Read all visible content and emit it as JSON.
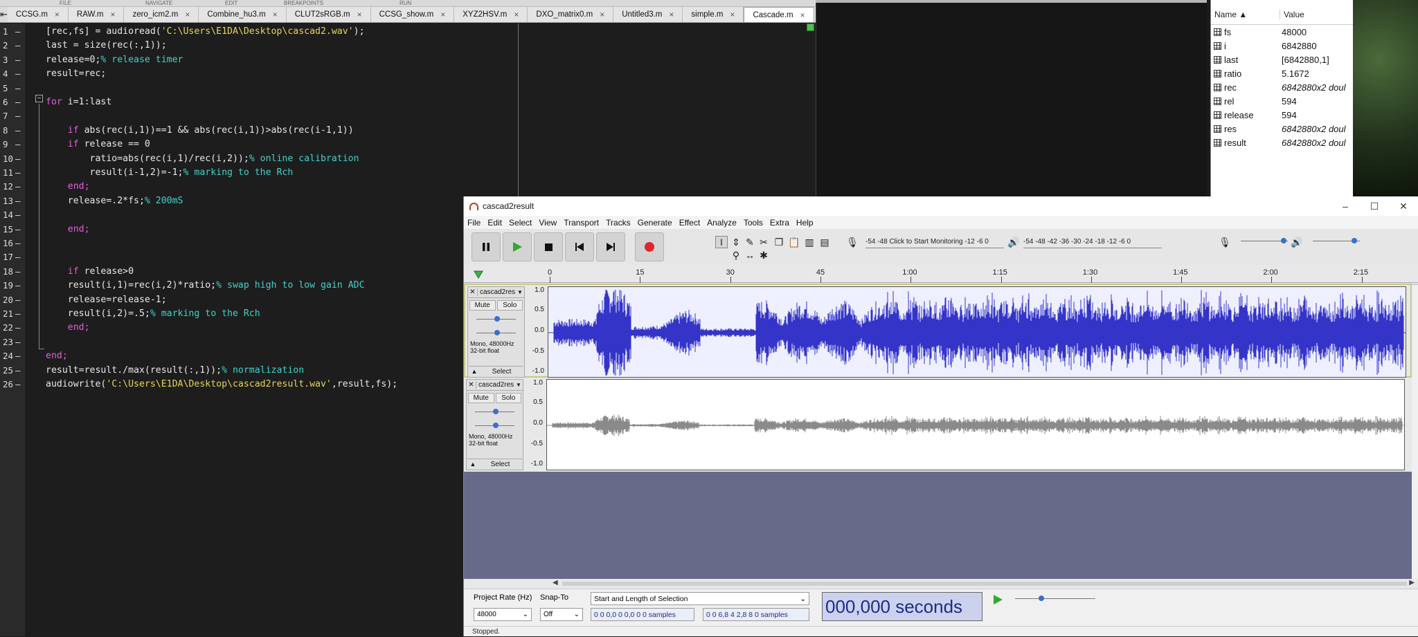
{
  "ribbon": {
    "labels": [
      "FILE",
      "NAVIGATE",
      "EDIT",
      "BREAKPOINTS",
      "RUN"
    ]
  },
  "editor": {
    "tabs": [
      "CCSG.m",
      "RAW.m",
      "zero_icm2.m",
      "Combine_hu3.m",
      "CLUT2sRGB.m",
      "CCSG_show.m",
      "XYZ2HSV.m",
      "DXO_matrix0.m",
      "Untitled3.m",
      "simple.m",
      "Cascade.m"
    ],
    "active_tab": "Cascade.m",
    "plus": "+",
    "line_numbers": [
      "1",
      "2",
      "3",
      "4",
      "5",
      "6",
      "7",
      "8",
      "9",
      "10",
      "11",
      "12",
      "13",
      "14",
      "15",
      "16",
      "17",
      "18",
      "19",
      "20",
      "21",
      "22",
      "23",
      "24",
      "25",
      "26"
    ],
    "lines": [
      [
        {
          "t": "[rec,fs] = audioread(",
          "c": ""
        },
        {
          "t": "'C:\\Users\\E1DA\\Desktop\\cascad2.wav'",
          "c": "str"
        },
        {
          "t": ");",
          "c": ""
        }
      ],
      [
        {
          "t": "last = size(rec(:,1));",
          "c": ""
        }
      ],
      [
        {
          "t": "release=0;",
          "c": ""
        },
        {
          "t": "% release timer",
          "c": "cm"
        }
      ],
      [
        {
          "t": "result=rec;",
          "c": ""
        }
      ],
      [],
      [
        {
          "t": "for",
          "c": "kw"
        },
        {
          "t": " i=1:last",
          "c": ""
        }
      ],
      [],
      [
        {
          "t": "    ",
          "c": ""
        },
        {
          "t": "if",
          "c": "kw"
        },
        {
          "t": " abs(rec(i,1))==1 && abs(rec(i,1))>abs(rec(i-1,1))",
          "c": ""
        }
      ],
      [
        {
          "t": "    ",
          "c": ""
        },
        {
          "t": "if",
          "c": "kw"
        },
        {
          "t": " release == 0",
          "c": ""
        }
      ],
      [
        {
          "t": "        ratio=abs(rec(i,1)/rec(i,2));",
          "c": ""
        },
        {
          "t": "% online calibration",
          "c": "cm"
        }
      ],
      [
        {
          "t": "        result(i-1,2)=-1;",
          "c": ""
        },
        {
          "t": "% marking to the Rch",
          "c": "cm"
        }
      ],
      [
        {
          "t": "    ",
          "c": ""
        },
        {
          "t": "end;",
          "c": "kw"
        }
      ],
      [
        {
          "t": "    release=.2*fs;",
          "c": ""
        },
        {
          "t": "% 200mS",
          "c": "cm"
        }
      ],
      [],
      [
        {
          "t": "    ",
          "c": ""
        },
        {
          "t": "end;",
          "c": "kw"
        }
      ],
      [],
      [],
      [
        {
          "t": "    ",
          "c": ""
        },
        {
          "t": "if",
          "c": "kw"
        },
        {
          "t": " release>0",
          "c": ""
        }
      ],
      [
        {
          "t": "    result(i,1)=rec(i,2)*ratio;",
          "c": ""
        },
        {
          "t": "% swap high to low gain ADC",
          "c": "cm"
        }
      ],
      [
        {
          "t": "    release=release-1;",
          "c": ""
        }
      ],
      [
        {
          "t": "    result(i,2)=.5;",
          "c": ""
        },
        {
          "t": "% marking to the Rch",
          "c": "cm"
        }
      ],
      [
        {
          "t": "    ",
          "c": ""
        },
        {
          "t": "end;",
          "c": "kw"
        }
      ],
      [],
      [
        {
          "t": "end;",
          "c": "kw"
        }
      ],
      [
        {
          "t": "result=result./max(result(:,1));",
          "c": ""
        },
        {
          "t": "% normalization",
          "c": "cm"
        }
      ],
      [
        {
          "t": "audiowrite(",
          "c": ""
        },
        {
          "t": "'C:\\Users\\E1DA\\Desktop\\cascad2result.wav'",
          "c": "str"
        },
        {
          "t": ",result,fs);",
          "c": ""
        }
      ]
    ]
  },
  "workspace": {
    "col_name": "Name ▲",
    "col_value": "Value",
    "vars": [
      {
        "name": "fs",
        "value": "48000",
        "italic": false
      },
      {
        "name": "i",
        "value": "6842880",
        "italic": false
      },
      {
        "name": "last",
        "value": "[6842880,1]",
        "italic": false
      },
      {
        "name": "ratio",
        "value": "5.1672",
        "italic": false
      },
      {
        "name": "rec",
        "value": "6842880x2 doul",
        "italic": true
      },
      {
        "name": "rel",
        "value": "594",
        "italic": false
      },
      {
        "name": "release",
        "value": "594",
        "italic": false
      },
      {
        "name": "res",
        "value": "6842880x2 doul",
        "italic": true
      },
      {
        "name": "result",
        "value": "6842880x2 doul",
        "italic": true
      }
    ]
  },
  "audacity": {
    "title": "cascad2result",
    "menu": [
      "File",
      "Edit",
      "Select",
      "View",
      "Transport",
      "Tracks",
      "Generate",
      "Effect",
      "Analyze",
      "Tools",
      "Extra",
      "Help"
    ],
    "rec_meter_text": "-54  -48  Click to Start Monitoring  -12  -6  0",
    "play_meter_text": "-54  -48  -42  -36  -30  -24  -18  -12  -6  0",
    "ruler": [
      "0",
      "15",
      "30",
      "45",
      "1:00",
      "1:15",
      "1:30",
      "1:45",
      "2:00",
      "2:15"
    ],
    "tracks": [
      {
        "name": "cascad2res",
        "mute": "Mute",
        "solo": "Solo",
        "format1": "Mono, 48000Hz",
        "format2": "32-bit float",
        "select": "Select",
        "scale": [
          "1.0",
          "0.5",
          "0.0",
          "-0.5",
          "-1.0"
        ],
        "color": "#3434c8"
      },
      {
        "name": "cascad2res",
        "mute": "Mute",
        "solo": "Solo",
        "format1": "Mono, 48000Hz",
        "format2": "32-bit float",
        "select": "Select",
        "scale": [
          "1.0",
          "0.5",
          "0.0",
          "-0.5",
          "-1.0"
        ],
        "color": "#8a8a8a"
      }
    ],
    "bottom": {
      "project_rate_label": "Project Rate (Hz)",
      "project_rate": "48000",
      "snap_label": "Snap-To",
      "snap_value": "Off",
      "selection_mode": "Start and Length of Selection",
      "sel_start": "0 0 0,0 0 0,0 0 0 samples",
      "sel_length": "0 0 6,8 4 2,8 8 0 samples",
      "time_display": "000,000 seconds",
      "status": "Stopped."
    }
  }
}
